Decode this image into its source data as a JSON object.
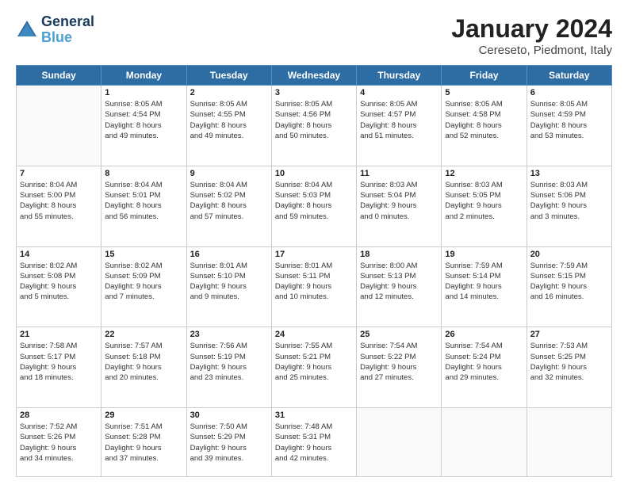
{
  "header": {
    "logo_line1": "General",
    "logo_line2": "Blue",
    "main_title": "January 2024",
    "subtitle": "Cereseto, Piedmont, Italy"
  },
  "days_of_week": [
    "Sunday",
    "Monday",
    "Tuesday",
    "Wednesday",
    "Thursday",
    "Friday",
    "Saturday"
  ],
  "weeks": [
    [
      {
        "day": "",
        "info": ""
      },
      {
        "day": "1",
        "info": "Sunrise: 8:05 AM\nSunset: 4:54 PM\nDaylight: 8 hours\nand 49 minutes."
      },
      {
        "day": "2",
        "info": "Sunrise: 8:05 AM\nSunset: 4:55 PM\nDaylight: 8 hours\nand 49 minutes."
      },
      {
        "day": "3",
        "info": "Sunrise: 8:05 AM\nSunset: 4:56 PM\nDaylight: 8 hours\nand 50 minutes."
      },
      {
        "day": "4",
        "info": "Sunrise: 8:05 AM\nSunset: 4:57 PM\nDaylight: 8 hours\nand 51 minutes."
      },
      {
        "day": "5",
        "info": "Sunrise: 8:05 AM\nSunset: 4:58 PM\nDaylight: 8 hours\nand 52 minutes."
      },
      {
        "day": "6",
        "info": "Sunrise: 8:05 AM\nSunset: 4:59 PM\nDaylight: 8 hours\nand 53 minutes."
      }
    ],
    [
      {
        "day": "7",
        "info": "Sunrise: 8:04 AM\nSunset: 5:00 PM\nDaylight: 8 hours\nand 55 minutes."
      },
      {
        "day": "8",
        "info": "Sunrise: 8:04 AM\nSunset: 5:01 PM\nDaylight: 8 hours\nand 56 minutes."
      },
      {
        "day": "9",
        "info": "Sunrise: 8:04 AM\nSunset: 5:02 PM\nDaylight: 8 hours\nand 57 minutes."
      },
      {
        "day": "10",
        "info": "Sunrise: 8:04 AM\nSunset: 5:03 PM\nDaylight: 8 hours\nand 59 minutes."
      },
      {
        "day": "11",
        "info": "Sunrise: 8:03 AM\nSunset: 5:04 PM\nDaylight: 9 hours\nand 0 minutes."
      },
      {
        "day": "12",
        "info": "Sunrise: 8:03 AM\nSunset: 5:05 PM\nDaylight: 9 hours\nand 2 minutes."
      },
      {
        "day": "13",
        "info": "Sunrise: 8:03 AM\nSunset: 5:06 PM\nDaylight: 9 hours\nand 3 minutes."
      }
    ],
    [
      {
        "day": "14",
        "info": "Sunrise: 8:02 AM\nSunset: 5:08 PM\nDaylight: 9 hours\nand 5 minutes."
      },
      {
        "day": "15",
        "info": "Sunrise: 8:02 AM\nSunset: 5:09 PM\nDaylight: 9 hours\nand 7 minutes."
      },
      {
        "day": "16",
        "info": "Sunrise: 8:01 AM\nSunset: 5:10 PM\nDaylight: 9 hours\nand 9 minutes."
      },
      {
        "day": "17",
        "info": "Sunrise: 8:01 AM\nSunset: 5:11 PM\nDaylight: 9 hours\nand 10 minutes."
      },
      {
        "day": "18",
        "info": "Sunrise: 8:00 AM\nSunset: 5:13 PM\nDaylight: 9 hours\nand 12 minutes."
      },
      {
        "day": "19",
        "info": "Sunrise: 7:59 AM\nSunset: 5:14 PM\nDaylight: 9 hours\nand 14 minutes."
      },
      {
        "day": "20",
        "info": "Sunrise: 7:59 AM\nSunset: 5:15 PM\nDaylight: 9 hours\nand 16 minutes."
      }
    ],
    [
      {
        "day": "21",
        "info": "Sunrise: 7:58 AM\nSunset: 5:17 PM\nDaylight: 9 hours\nand 18 minutes."
      },
      {
        "day": "22",
        "info": "Sunrise: 7:57 AM\nSunset: 5:18 PM\nDaylight: 9 hours\nand 20 minutes."
      },
      {
        "day": "23",
        "info": "Sunrise: 7:56 AM\nSunset: 5:19 PM\nDaylight: 9 hours\nand 23 minutes."
      },
      {
        "day": "24",
        "info": "Sunrise: 7:55 AM\nSunset: 5:21 PM\nDaylight: 9 hours\nand 25 minutes."
      },
      {
        "day": "25",
        "info": "Sunrise: 7:54 AM\nSunset: 5:22 PM\nDaylight: 9 hours\nand 27 minutes."
      },
      {
        "day": "26",
        "info": "Sunrise: 7:54 AM\nSunset: 5:24 PM\nDaylight: 9 hours\nand 29 minutes."
      },
      {
        "day": "27",
        "info": "Sunrise: 7:53 AM\nSunset: 5:25 PM\nDaylight: 9 hours\nand 32 minutes."
      }
    ],
    [
      {
        "day": "28",
        "info": "Sunrise: 7:52 AM\nSunset: 5:26 PM\nDaylight: 9 hours\nand 34 minutes."
      },
      {
        "day": "29",
        "info": "Sunrise: 7:51 AM\nSunset: 5:28 PM\nDaylight: 9 hours\nand 37 minutes."
      },
      {
        "day": "30",
        "info": "Sunrise: 7:50 AM\nSunset: 5:29 PM\nDaylight: 9 hours\nand 39 minutes."
      },
      {
        "day": "31",
        "info": "Sunrise: 7:48 AM\nSunset: 5:31 PM\nDaylight: 9 hours\nand 42 minutes."
      },
      {
        "day": "",
        "info": ""
      },
      {
        "day": "",
        "info": ""
      },
      {
        "day": "",
        "info": ""
      }
    ]
  ]
}
